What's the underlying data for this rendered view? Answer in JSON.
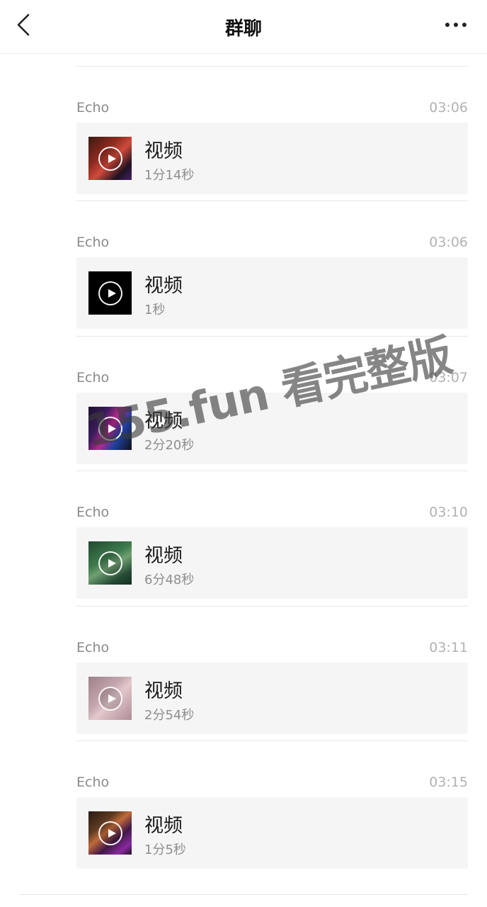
{
  "header": {
    "title": "群聊",
    "back_icon": "chevron-left-icon",
    "more_icon": "more-dots-icon"
  },
  "messages": [
    {
      "sender": "Echo",
      "time": "03:06",
      "title": "视频",
      "duration": "1分14秒",
      "thumb_icon": "play-icon"
    },
    {
      "sender": "Echo",
      "time": "03:06",
      "title": "视频",
      "duration": "1秒",
      "thumb_icon": "play-icon"
    },
    {
      "sender": "Echo",
      "time": "03:07",
      "title": "视频",
      "duration": "2分20秒",
      "thumb_icon": "play-icon"
    },
    {
      "sender": "Echo",
      "time": "03:10",
      "title": "视频",
      "duration": "6分48秒",
      "thumb_icon": "play-icon"
    },
    {
      "sender": "Echo",
      "time": "03:11",
      "title": "视频",
      "duration": "2分54秒",
      "thumb_icon": "play-icon"
    },
    {
      "sender": "Echo",
      "time": "03:15",
      "title": "视频",
      "duration": "1分5秒",
      "thumb_icon": "play-icon"
    }
  ],
  "watermark": "155.fun 看完整版",
  "colors": {
    "background": "#ffffff",
    "card_background": "#f5f5f5",
    "title_text": "#111111",
    "secondary_text": "#8a8a8a",
    "divider": "#e6e6e6"
  }
}
